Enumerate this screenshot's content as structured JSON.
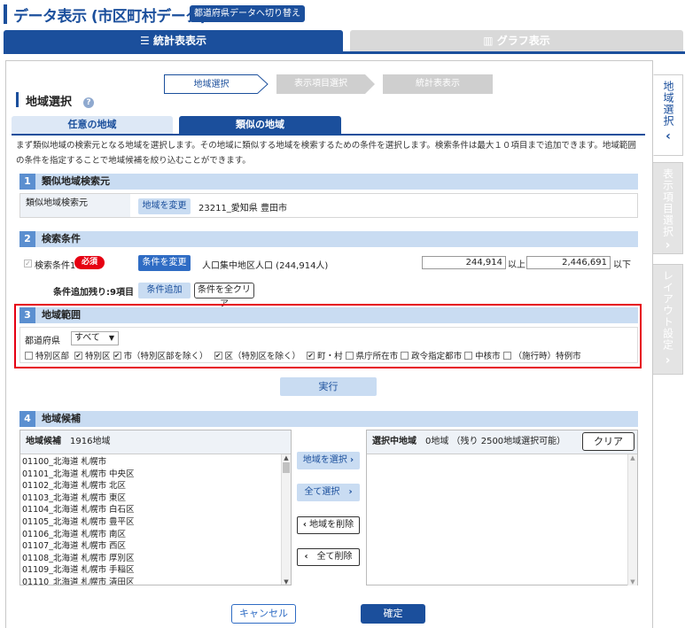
{
  "header": {
    "title": "データ表示 (市区町村データ)",
    "switch_label": "都道府県データへ切り替え"
  },
  "top_tabs": [
    {
      "label": "統計表表示"
    },
    {
      "label": "グラフ表示"
    }
  ],
  "steps": [
    "地域選択",
    "表示項目選択",
    "統計表表示"
  ],
  "section_title": "地域選択",
  "sub_tabs": [
    {
      "label": "任意の地域"
    },
    {
      "label": "類似の地域"
    }
  ],
  "description": "まず類似地域の検索元となる地域を選択します。その地域に類似する地域を検索するための条件を選択します。検索条件は最大１０項目まで追加できます。地域範囲の条件を指定することで地域候補を絞り込むことができます。",
  "sec1": {
    "num": "1",
    "title": "類似地域検索元",
    "label": "類似地域検索元",
    "change_btn": "地域を変更",
    "value": "23211_愛知県 豊田市"
  },
  "sec2": {
    "num": "2",
    "title": "検索条件",
    "cond_label": "検索条件1",
    "required": "必須",
    "change_btn": "条件を変更",
    "cond_name": "人口集中地区人口 (244,914人)",
    "min_value": "244,914",
    "min_suffix": "以上",
    "max_value": "2,446,691",
    "max_suffix": "以下",
    "remaining": "条件追加残り:9項目",
    "add_btn": "条件追加",
    "clear_btn": "条件を全クリア"
  },
  "sec3": {
    "num": "3",
    "title": "地域範囲",
    "pref_label": "都道府県",
    "pref_value": "すべて",
    "options": [
      {
        "label": "特別区部",
        "checked": false
      },
      {
        "label": "特別区",
        "checked": true
      },
      {
        "label": "市（特別区部を除く）",
        "checked": true
      },
      {
        "label": "区（特別区を除く）",
        "checked": true
      },
      {
        "label": "町・村",
        "checked": true
      },
      {
        "label": "県庁所在市",
        "checked": false
      },
      {
        "label": "政令指定都市",
        "checked": false
      },
      {
        "label": "中核市",
        "checked": false
      },
      {
        "label": "（施行時）特例市",
        "checked": false
      }
    ]
  },
  "run_btn": "実行",
  "sec4": {
    "num": "4",
    "title": "地域候補",
    "cand_label": "地域候補",
    "cand_count": "1916地域",
    "cand_items": [
      "01100_北海道 札幌市",
      "01101_北海道 札幌市 中央区",
      "01102_北海道 札幌市 北区",
      "01103_北海道 札幌市 東区",
      "01104_北海道 札幌市 白石区",
      "01105_北海道 札幌市 豊平区",
      "01106_北海道 札幌市 南区",
      "01107_北海道 札幌市 西区",
      "01108_北海道 札幌市 厚別区",
      "01109_北海道 札幌市 手稲区",
      "01110_北海道 札幌市 清田区"
    ],
    "select_btn": "地域を選択",
    "select_all_btn": "全て選択",
    "delete_btn": "地域を削除",
    "delete_all_btn": "全て削除",
    "sel_label": "選択中地域",
    "sel_count": "0地域 （残り 2500地域選択可能）",
    "clear_btn": "クリア"
  },
  "cancel_btn": "キャンセル",
  "ok_btn": "確定",
  "side_tabs": [
    {
      "label": "地域選択"
    },
    {
      "label": "表示項目選択"
    },
    {
      "label": "レイアウト設定"
    }
  ],
  "colors": {
    "primary": "#1b4f9c",
    "light": "#c9dcf2",
    "required": "#e60012"
  }
}
